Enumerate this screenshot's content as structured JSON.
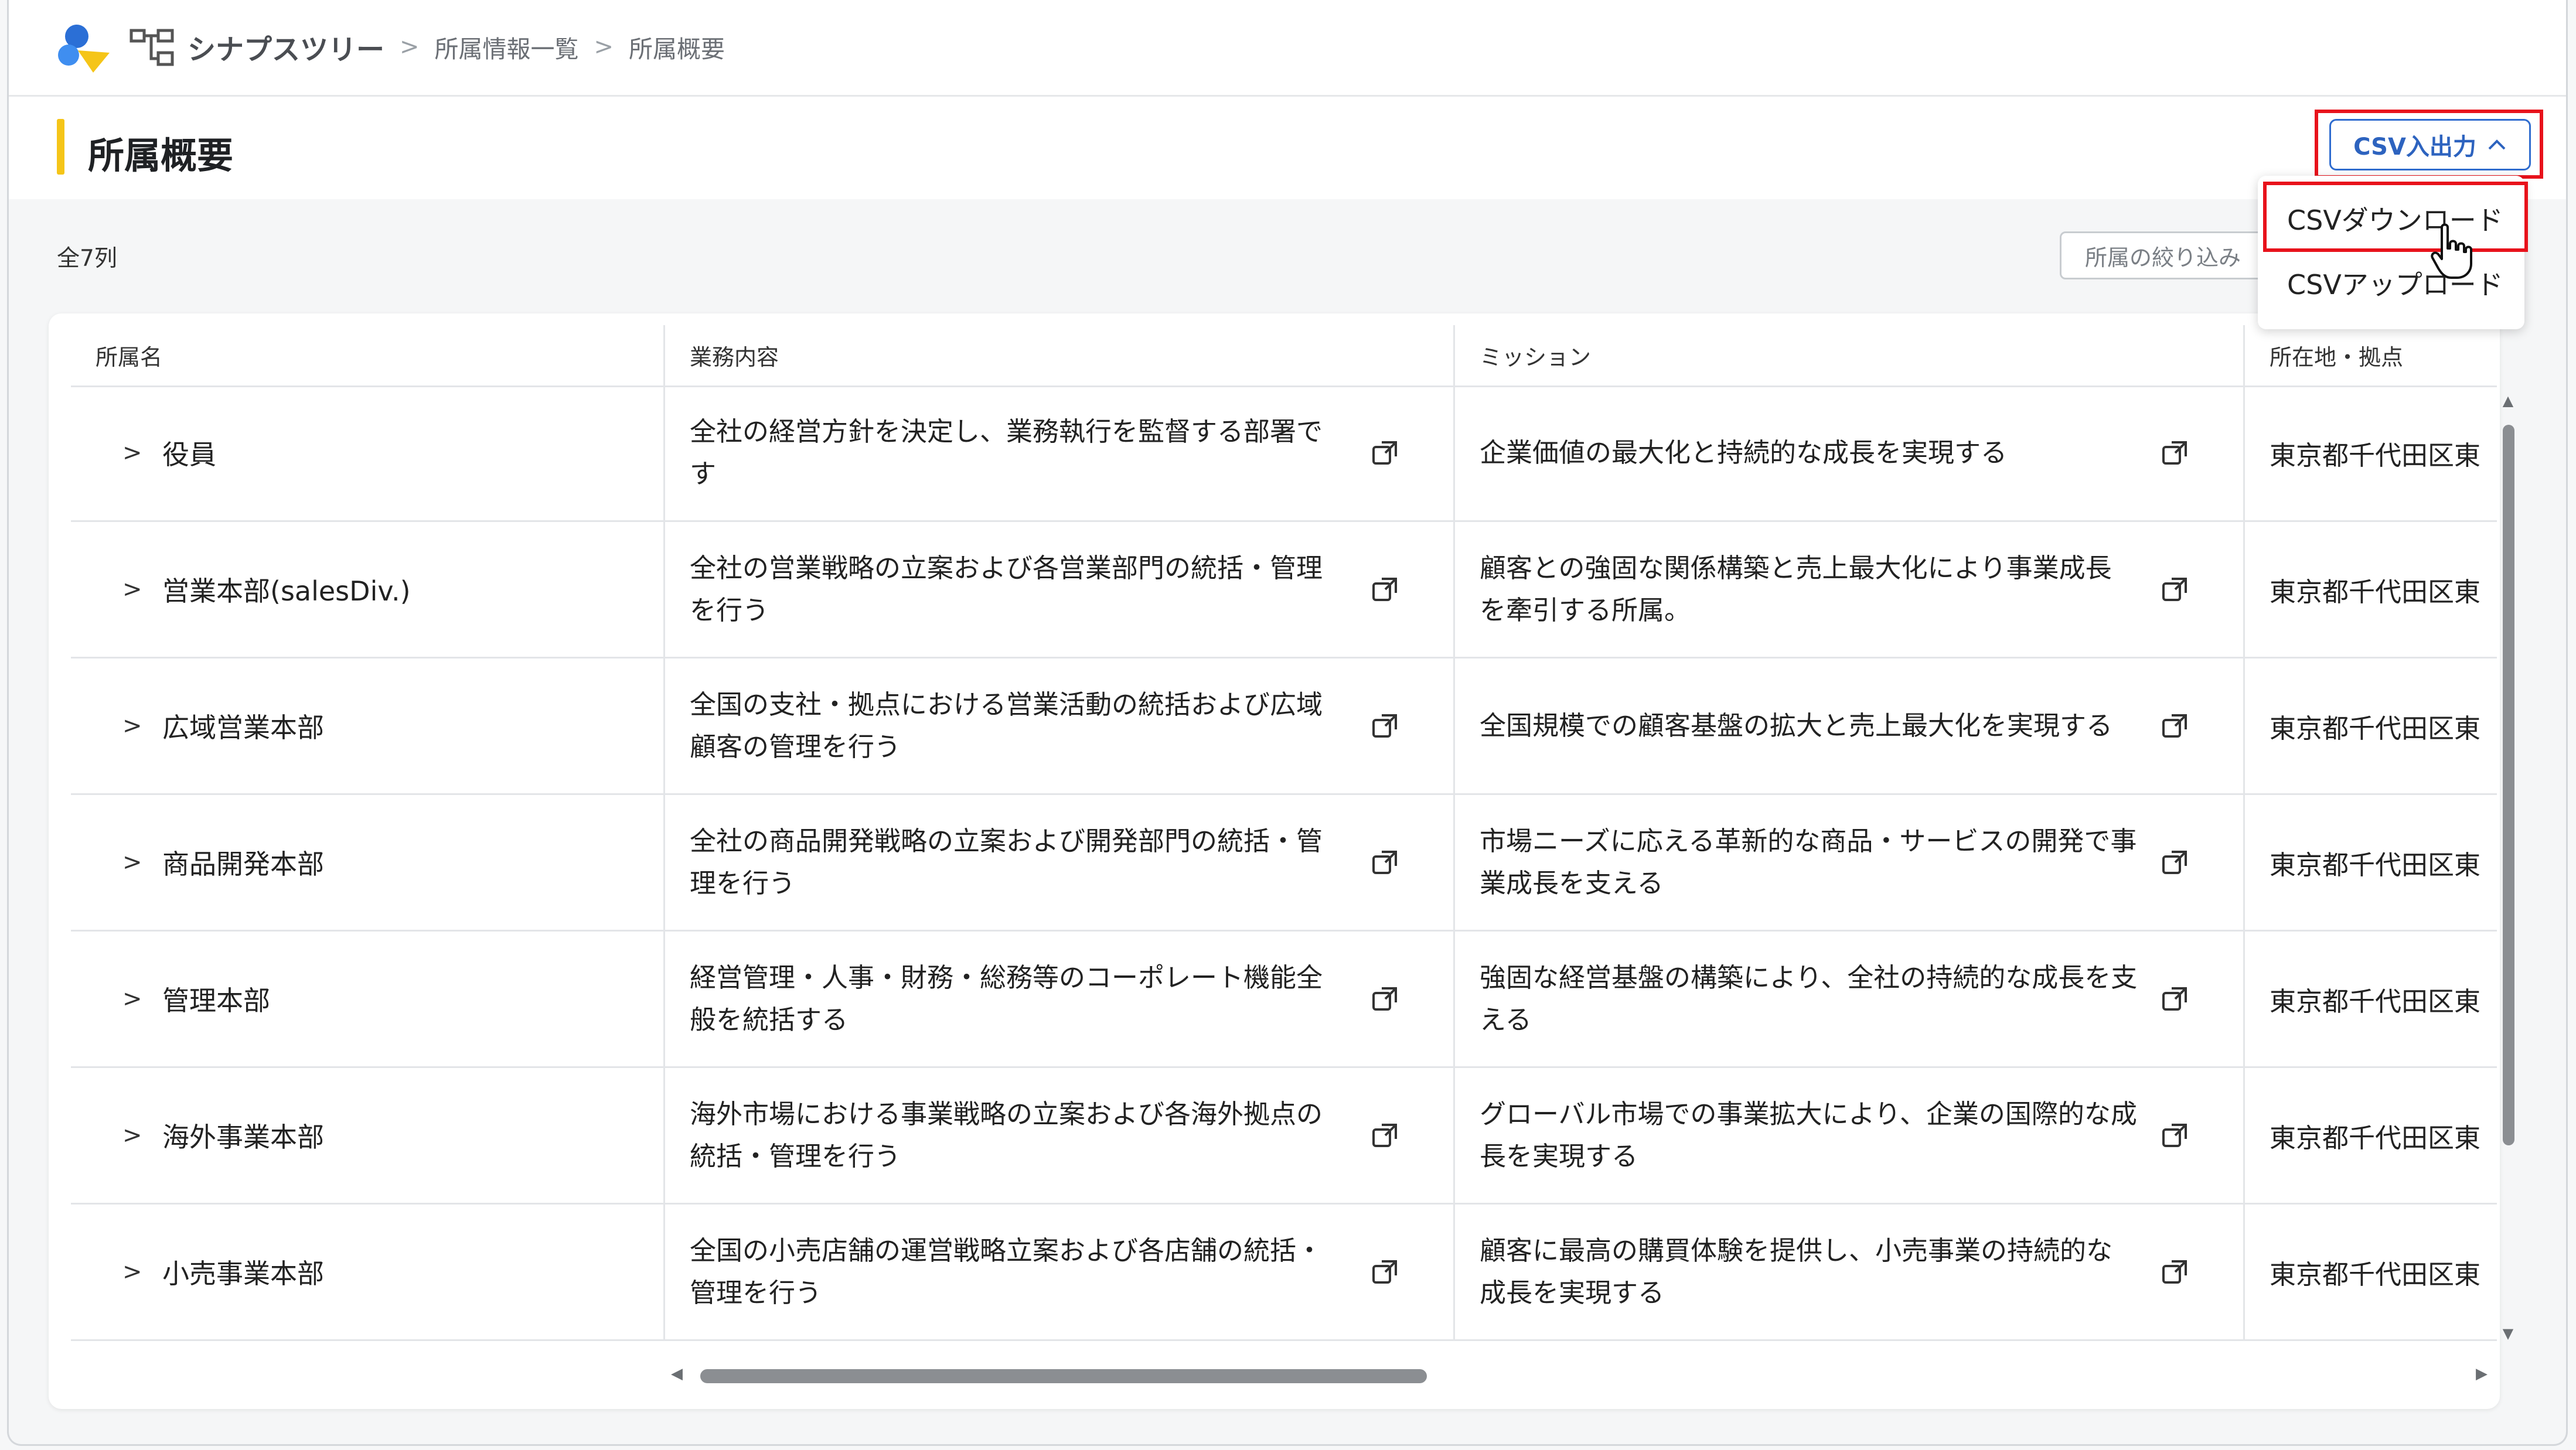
{
  "header": {
    "app_name": "シナプスツリー",
    "breadcrumb": [
      "所属情報一覧",
      "所属概要"
    ]
  },
  "page": {
    "title": "所属概要",
    "csv_button_label": "CSV入出力",
    "total_count": "全7列",
    "filter_button_label": "所属の絞り込み"
  },
  "dropdown": {
    "download_label": "CSVダウンロード",
    "upload_label": "CSVアップロード"
  },
  "table": {
    "columns": [
      "所属名",
      "業務内容",
      "ミッション",
      "所在地・拠点"
    ],
    "rows": [
      {
        "name": "役員",
        "business": "全社の経営方針を決定し、業務執行を監督する部署です",
        "mission": "企業価値の最大化と持続的な成長を実現する",
        "location": "東京都千代田区東"
      },
      {
        "name": "営業本部(salesDiv.)",
        "business": "全社の営業戦略の立案および各営業部門の統括・管理を行う",
        "mission": "顧客との強固な関係構築と売上最大化により事業成長を牽引する所属。",
        "location": "東京都千代田区東"
      },
      {
        "name": "広域営業本部",
        "business": "全国の支社・拠点における営業活動の統括および広域顧客の管理を行う",
        "mission": "全国規模での顧客基盤の拡大と売上最大化を実現する",
        "location": "東京都千代田区東"
      },
      {
        "name": "商品開発本部",
        "business": "全社の商品開発戦略の立案および開発部門の統括・管理を行う",
        "mission": "市場ニーズに応える革新的な商品・サービスの開発で事業成長を支える",
        "location": "東京都千代田区東"
      },
      {
        "name": "管理本部",
        "business": "経営管理・人事・財務・総務等のコーポレート機能全般を統括する",
        "mission": "強固な経営基盤の構築により、全社の持続的な成長を支える",
        "location": "東京都千代田区東"
      },
      {
        "name": "海外事業本部",
        "business": "海外市場における事業戦略の立案および各海外拠点の統括・管理を行う",
        "mission": "グローバル市場での事業拡大により、企業の国際的な成長を実現する",
        "location": "東京都千代田区東"
      },
      {
        "name": "小売事業本部",
        "business": "全国の小売店舗の運営戦略立案および各店舗の統括・管理を行う",
        "mission": "顧客に最高の購買体験を提供し、小売事業の持続的な成長を実現する",
        "location": "東京都千代田区東"
      }
    ]
  },
  "icons": {
    "logo": "app-logo-icon",
    "tree": "org-tree-icon",
    "row_expand": "chevron-right-icon",
    "external": "open-external-icon",
    "csv_chevron": "chevron-up-icon"
  },
  "colors": {
    "accent_yellow": "#f5c518",
    "primary_blue": "#2f6ccf",
    "highlight_red": "#e8121b"
  }
}
